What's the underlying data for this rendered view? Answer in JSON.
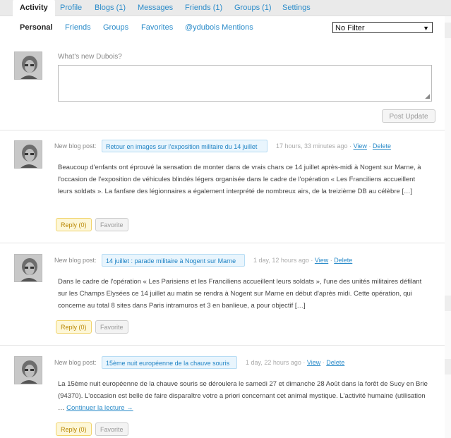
{
  "tabs": [
    {
      "label": "Activity"
    },
    {
      "label": "Profile"
    },
    {
      "label": "Blogs (1)"
    },
    {
      "label": "Messages"
    },
    {
      "label": "Friends (1)"
    },
    {
      "label": "Groups (1)"
    },
    {
      "label": "Settings"
    }
  ],
  "subnav": [
    {
      "label": "Personal"
    },
    {
      "label": "Friends"
    },
    {
      "label": "Groups"
    },
    {
      "label": "Favorites"
    },
    {
      "label": "@ydubois Mentions"
    }
  ],
  "filter": {
    "selected": "No Filter",
    "arrow": "▼"
  },
  "composer": {
    "label": "What's new Dubois?",
    "textarea_value": "",
    "grip": "◢",
    "post_button": "Post Update"
  },
  "activities": [
    {
      "type": "New blog post:",
      "title": "Retour en images sur l'exposition militaire du 14 juillet",
      "time": "17 hours, 33 minutes ago",
      "sep1": " · ",
      "view": "View",
      "sep2": " · ",
      "delete": "Delete",
      "body": "Beaucoup d'enfants ont éprouvé la sensation de monter dans de vrais chars ce 14 juillet après-midi à Nogent sur Marne, à l'occasion de l'exposition de véhicules blindés légers organisée dans le cadre de l'opération « Les Franciliens accueillent leurs soldats ». La fanfare des légionnaires a également interprété de nombreux airs, de la treizième DB au célèbre […]",
      "reply": "Reply (0)",
      "favorite": "Favorite"
    },
    {
      "type": "New blog post:",
      "title": "14 juillet : parade militaire à Nogent sur Marne",
      "time": "1 day, 12 hours ago",
      "sep1": " · ",
      "view": "View",
      "sep2": " · ",
      "delete": "Delete",
      "body": "Dans le cadre de l'opération « Les Parisiens et les Franciliens accueillent leurs soldats », l'une des unités militaires défilant sur les Champs Elysées ce 14 juillet au matin se rendra à Nogent sur Marne en début d'après midi. Cette opération, qui concerne au total 8 sites dans Paris intramuros et 3 en banlieue, a pour objectif […]",
      "reply": "Reply (0)",
      "favorite": "Favorite"
    },
    {
      "type": "New blog post:",
      "title": "15ème nuit européenne de la chauve souris",
      "time": "1 day, 22 hours ago",
      "sep1": " · ",
      "view": "View",
      "sep2": " · ",
      "delete": "Delete",
      "body": "La 15ème nuit européenne de la chauve souris se déroulera le samedi 27 et dimanche 28 Août dans la forêt de Sucy en Brie (94370).  L'occasion est belle de faire disparaître votre a priori concernant cet animal mystique. L'activité humaine (utilisation … ",
      "continue": "Continuer la lecture →",
      "reply": "Reply (0)",
      "favorite": "Favorite"
    }
  ]
}
